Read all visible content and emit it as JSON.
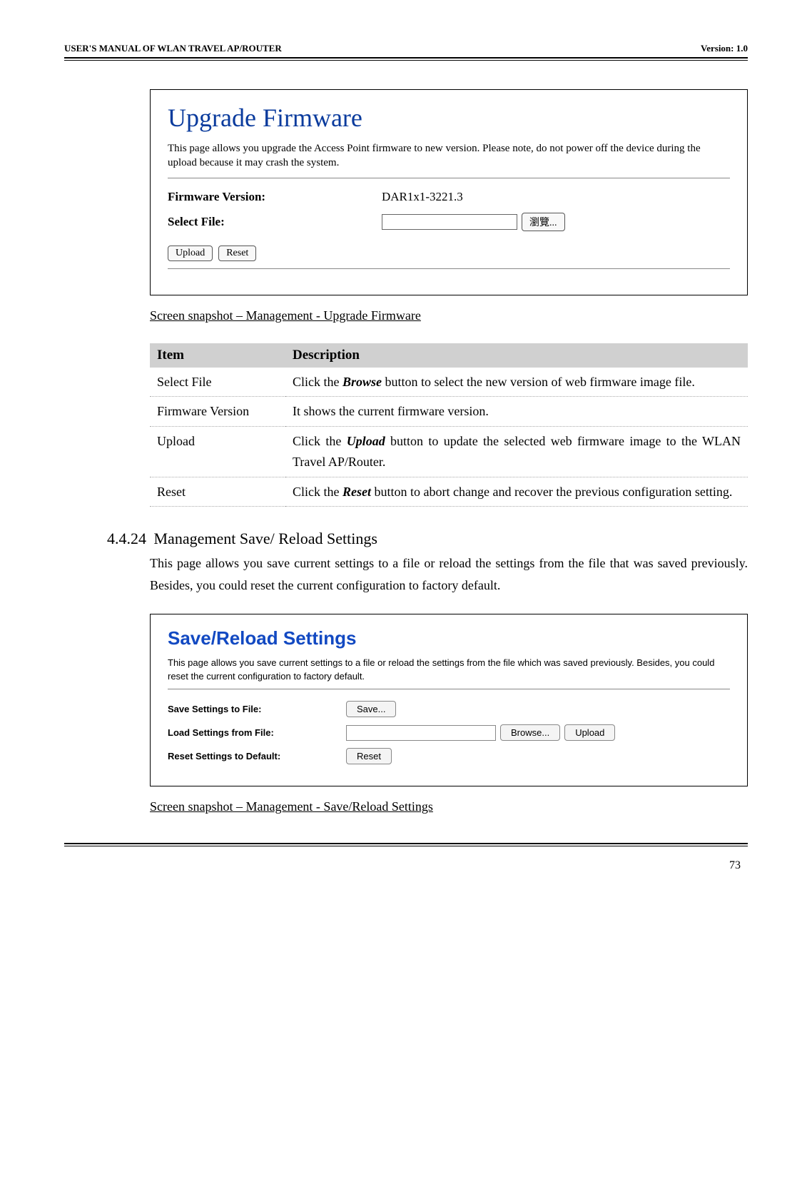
{
  "header": {
    "left": "USER'S MANUAL OF WLAN TRAVEL AP/ROUTER",
    "right": "Version: 1.0"
  },
  "upgrade_panel": {
    "title": "Upgrade Firmware",
    "description": "This page allows you upgrade the Access Point firmware to new version. Please note, do not power off the device during the upload because it may crash the system.",
    "firmware_version_label": "Firmware Version:",
    "firmware_version_value": "DAR1x1-3221.3",
    "select_file_label": "Select File:",
    "browse_button": "瀏覽...",
    "upload_button": "Upload",
    "reset_button": "Reset"
  },
  "upgrade_caption": "Screen snapshot – Management - Upgrade Firmware",
  "desc_table": {
    "header_item": "Item",
    "header_desc": "Description",
    "rows": [
      {
        "item": "Select File",
        "desc_pre": "Click the ",
        "desc_bold": "Browse",
        "desc_post": " button to select the new version of web firmware image file."
      },
      {
        "item": "Firmware Version",
        "desc_pre": "It shows the current firmware version.",
        "desc_bold": "",
        "desc_post": ""
      },
      {
        "item": "Upload",
        "desc_pre": "Click the ",
        "desc_bold": "Upload",
        "desc_post": " button to update the selected web firmware image to the WLAN Travel AP/Router."
      },
      {
        "item": "Reset",
        "desc_pre": "Click the ",
        "desc_bold": "Reset",
        "desc_post": " button to abort change and recover the previous configuration setting."
      }
    ]
  },
  "section": {
    "number": "4.4.24",
    "title": "Management Save/ Reload Settings",
    "body": "This page allows you save current settings to a file or reload the settings from the file that was saved previously. Besides, you could reset the current configuration to factory default."
  },
  "save_panel": {
    "title": "Save/Reload Settings",
    "description": "This page allows you save current settings to a file or reload the settings from the file which was saved previously. Besides, you could reset the current configuration to factory default.",
    "save_label": "Save Settings to File:",
    "save_button": "Save...",
    "load_label": "Load Settings from File:",
    "browse_button": "Browse...",
    "upload_button": "Upload",
    "reset_label": "Reset Settings to Default:",
    "reset_button": "Reset"
  },
  "save_caption": "Screen snapshot – Management - Save/Reload Settings",
  "page_number": "73"
}
